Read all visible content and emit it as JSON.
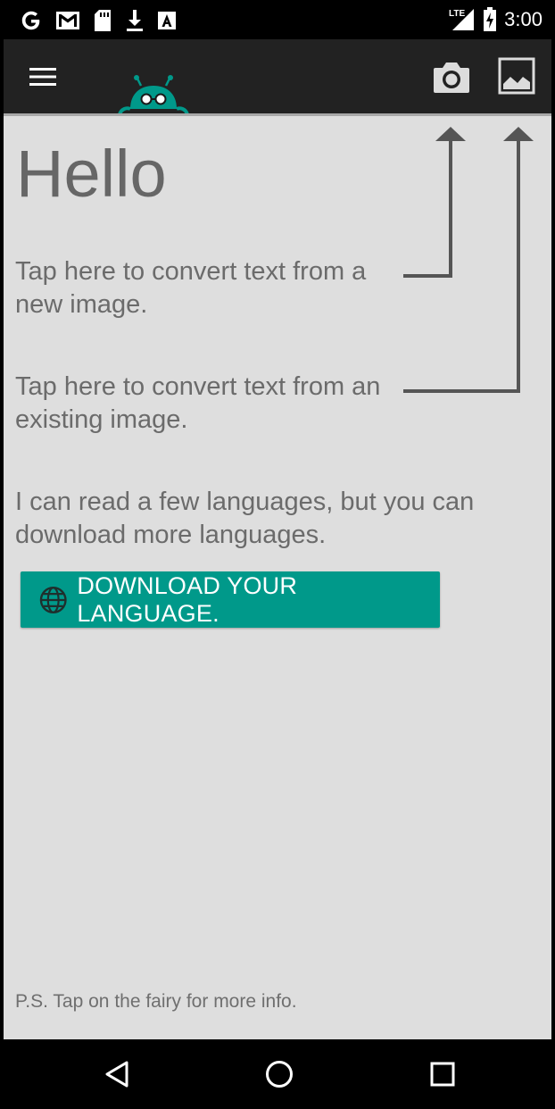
{
  "status_bar": {
    "left_icons": [
      "google-icon",
      "gmail-icon",
      "sd-card-icon",
      "download-icon",
      "font-a-icon"
    ],
    "network": "LTE",
    "time": "3:00"
  },
  "app_bar": {
    "menu_icon": "hamburger-menu-icon",
    "mascot_icon": "fairy-mascot-icon",
    "camera_icon": "camera-icon",
    "gallery_icon": "image-gallery-icon"
  },
  "main": {
    "hello": "Hello",
    "tip_camera": "Tap here to convert text from a new image.",
    "tip_gallery": "Tap here to convert text from an existing image.",
    "languages_note": "I can read a few languages, but you can download more languages.",
    "download_button": "DOWNLOAD YOUR LANGUAGE.",
    "download_icon": "globe-icon",
    "ps_note": "P.S. Tap on the fairy for more info."
  },
  "nav_bar": {
    "back_icon": "back-triangle-icon",
    "home_icon": "home-circle-icon",
    "recents_icon": "recents-square-icon"
  },
  "colors": {
    "accent": "#00998a",
    "app_bar": "#222222",
    "content_bg": "#dedede",
    "text": "#6b6b6b"
  }
}
